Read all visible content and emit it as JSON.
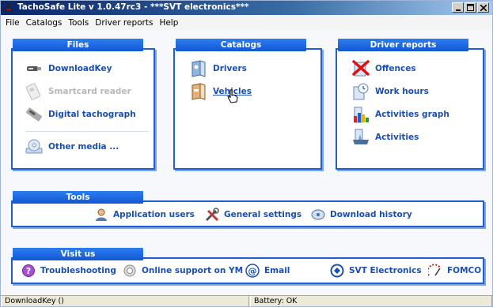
{
  "window": {
    "title": "TachoSafe Lite v 1.0.47rc3 - ***SVT electronics***"
  },
  "menu": [
    "File",
    "Catalogs",
    "Tools",
    "Driver reports",
    "Help"
  ],
  "files": {
    "tab": "Files",
    "items": [
      {
        "label": "DownloadKey",
        "icon": "usb-key-icon",
        "state": "enabled"
      },
      {
        "label": "Smartcard reader",
        "icon": "smartcard-reader-icon",
        "state": "disabled"
      },
      {
        "label": "Digital tachograph",
        "icon": "tachograph-icon",
        "state": "enabled"
      },
      {
        "label": "Other media ...",
        "icon": "cd-drive-icon",
        "state": "enabled"
      }
    ]
  },
  "catalogs": {
    "tab": "Catalogs",
    "items": [
      {
        "label": "Drivers",
        "icon": "drivers-book-icon"
      },
      {
        "label": "Vehicles",
        "icon": "vehicles-book-icon"
      }
    ]
  },
  "driver_reports": {
    "tab": "Driver reports",
    "items": [
      {
        "label": "Offences",
        "icon": "offences-icon"
      },
      {
        "label": "Work hours",
        "icon": "work-hours-icon"
      },
      {
        "label": "Activities graph",
        "icon": "activities-graph-icon"
      },
      {
        "label": "Activities",
        "icon": "activities-icon"
      }
    ]
  },
  "tools": {
    "tab": "Tools",
    "items": [
      {
        "label": "Application users",
        "icon": "user-icon"
      },
      {
        "label": "General settings",
        "icon": "tools-icon"
      },
      {
        "label": "Download history",
        "icon": "history-icon"
      }
    ]
  },
  "visit": {
    "tab": "Visit us",
    "items": [
      {
        "label": "Troubleshooting",
        "icon": "help-icon"
      },
      {
        "label": "Online support on YM",
        "icon": "chat-icon"
      },
      {
        "label": "Email",
        "icon": "email-icon"
      },
      {
        "label": "SVT Electronics",
        "icon": "svt-logo-icon"
      },
      {
        "label": "FOMCO",
        "icon": "fomco-logo-icon"
      }
    ]
  },
  "status": {
    "left": "DownloadKey ()",
    "right": "Battery: OK"
  },
  "colors": {
    "accent": "#1f5fd0",
    "link": "#1a4fb0",
    "disabled": "#b8b8b8"
  }
}
